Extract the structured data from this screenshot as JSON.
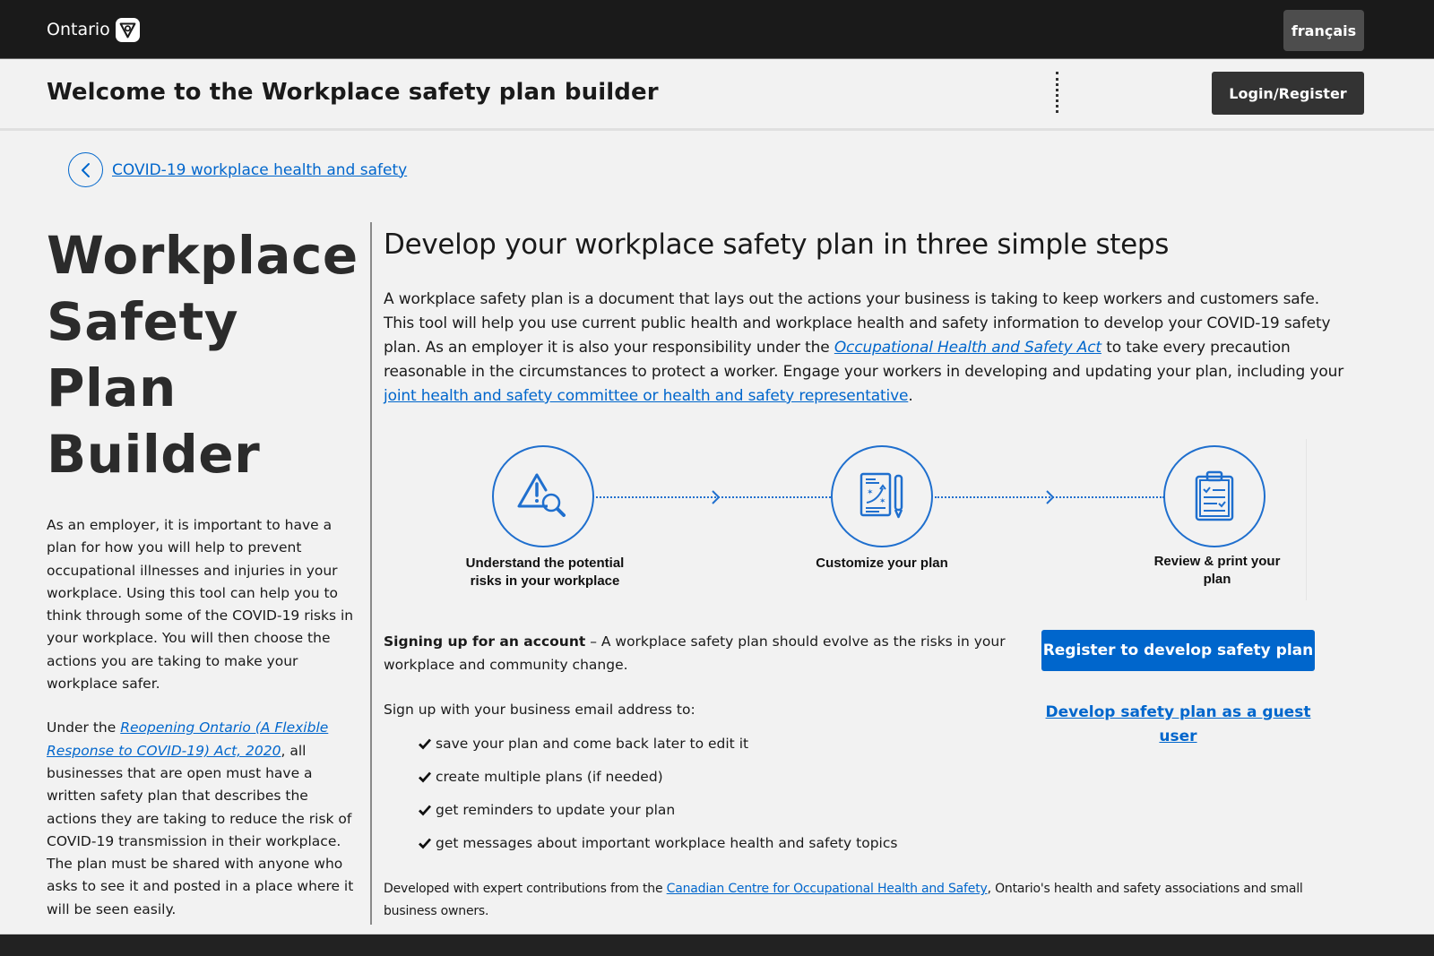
{
  "topbar": {
    "logo_text": "Ontario",
    "language_button": "français"
  },
  "appbar": {
    "title": "Welcome to the Workplace safety plan builder",
    "login_button": "Login/Register"
  },
  "back_link": {
    "label": "COVID-19 workplace health and safety"
  },
  "left": {
    "title_lines": [
      "Workplace",
      "Safety Plan",
      "Builder"
    ],
    "paragraph1": "As an employer, it is important to have a plan for how you will help to prevent occupational illnesses and injuries in your workplace. Using this tool can help you to think through some of the COVID-19 risks in your workplace. You will then choose the actions you are taking to make your workplace safer.",
    "paragraph2_prefix": "Under the ",
    "paragraph2_link": "Reopening Ontario (A Flexible Response to COVID-19) Act, 2020",
    "paragraph2_suffix": ", all businesses that are open must have a written safety plan that describes the actions they are taking to reduce the risk of COVID-19 transmission in their workplace. The plan must be shared with anyone who asks to see it and posted in a place where it will be seen easily."
  },
  "main": {
    "heading": "Develop your workplace safety plan in three simple steps",
    "intro_part1": "A workplace safety plan is a document that lays out the actions your business is taking to keep workers and customers safe. This tool will help you use current public health and workplace health and safety information to develop your COVID-19 safety plan. As an employer it is also your responsibility under the ",
    "intro_link1": "Occupational Health and Safety Act",
    "intro_part2": " to take every precaution reasonable in the circumstances to protect a worker. Engage your workers in developing and updating your plan, including your ",
    "intro_link2": "joint health and safety committee or health and safety representative",
    "intro_part3": ".",
    "steps": [
      {
        "icon": "warning-search-icon",
        "label": "Understand the potential risks in your workplace"
      },
      {
        "icon": "plan-strategy-icon",
        "label": "Customize your plan"
      },
      {
        "icon": "clipboard-checklist-icon",
        "label": "Review & print your plan"
      }
    ],
    "signup": {
      "bold": "Signing up for an account",
      "text": " – A workplace safety plan should evolve as the risks in your workplace and community change.",
      "lead": "Sign up with your business email address to:",
      "benefits": [
        "save your plan and come back later to edit it",
        "create multiple plans (if needed)",
        "get reminders to update your plan",
        "get messages about important workplace health and safety topics"
      ]
    },
    "register_button": "Register to develop safety plan",
    "guest_link": "Develop safety plan as a guest user",
    "credits_prefix": "Developed with expert contributions from the ",
    "credits_link": "Canadian Centre for Occupational Health and Safety",
    "credits_suffix": ", Ontario's health and safety associations and small business owners."
  },
  "colors": {
    "topbar": "#1a1a1a",
    "accent_blue": "#0066cc",
    "page_bg": "#f2f2f2",
    "dark_button": "#333333",
    "footer": "#222222"
  }
}
